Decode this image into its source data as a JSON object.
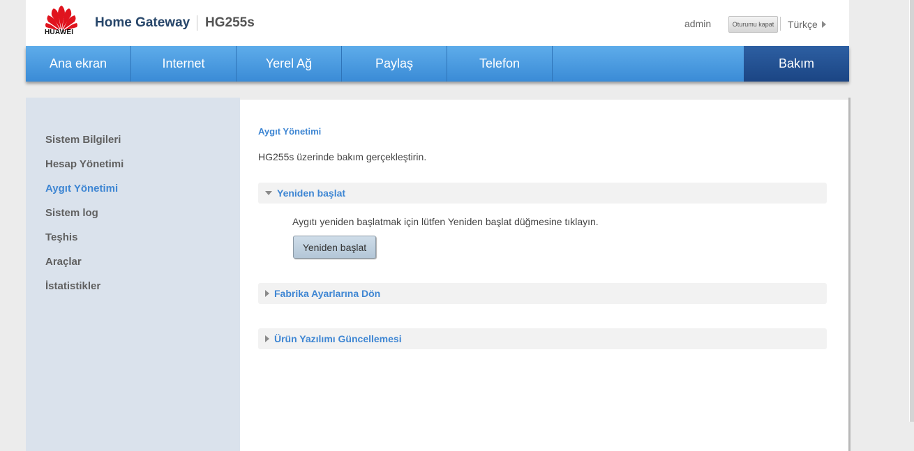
{
  "header": {
    "logo_text": "HUAWEI",
    "app_title": "Home Gateway",
    "model": "HG255s",
    "user": "admin",
    "logout_label": "Oturumu kapat",
    "language": "Türkçe"
  },
  "nav": {
    "tabs": [
      {
        "label": "Ana ekran"
      },
      {
        "label": "Internet"
      },
      {
        "label": "Yerel Ağ"
      },
      {
        "label": "Paylaş"
      },
      {
        "label": "Telefon"
      },
      {
        "label": "Bakım"
      }
    ],
    "active_index": 5
  },
  "sidebar": {
    "items": [
      {
        "label": "Sistem Bilgileri"
      },
      {
        "label": "Hesap Yönetimi"
      },
      {
        "label": "Aygıt Yönetimi"
      },
      {
        "label": "Sistem log"
      },
      {
        "label": "Teşhis"
      },
      {
        "label": "Araçlar"
      },
      {
        "label": "İstatistikler"
      }
    ],
    "active_index": 2
  },
  "main": {
    "title": "Aygıt Yönetimi",
    "description": "HG255s üzerinde bakım gerçekleştirin.",
    "sections": [
      {
        "title": "Yeniden başlat",
        "expanded": true,
        "text": "Aygıtı yeniden başlatmak için lütfen Yeniden başlat düğmesine tıklayın.",
        "button_label": "Yeniden başlat"
      },
      {
        "title": "Fabrika Ayarlarına Dön",
        "expanded": false
      },
      {
        "title": "Ürün Yazılımı Güncellemesi",
        "expanded": false
      }
    ]
  },
  "colors": {
    "nav_blue": "#4a9de0",
    "nav_active": "#21508f",
    "link_blue": "#3e86d3",
    "sidebar_bg": "#dae2ec",
    "brand_red": "#e0141e"
  }
}
